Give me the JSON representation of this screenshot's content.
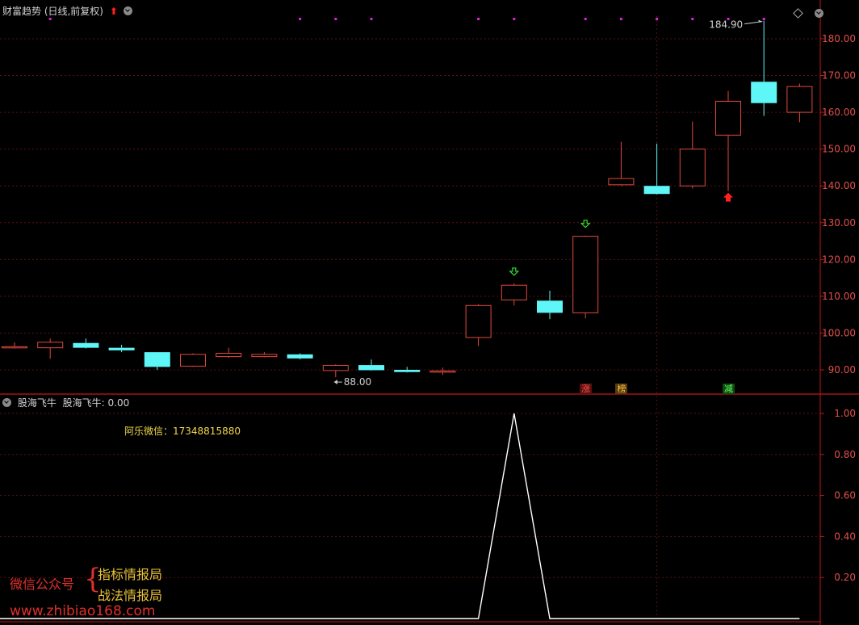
{
  "main_panel": {
    "title": "财富趋势 (日线,前复权)",
    "up_icon": "red-up-arrow-icon",
    "menu_icon": "dropdown-circle-icon"
  },
  "sub_panel": {
    "title": "股海飞牛",
    "value_label": "股海飞牛: 0.00",
    "wechat": "阿乐微信：17348815880"
  },
  "watermark": {
    "line1": "微信公众号",
    "brace": "{",
    "line2": "指标情报局",
    "line3": "战法情报局",
    "line4": "www.zhibiao168.com"
  },
  "stamps": [
    {
      "text": "涨",
      "color": "#ff5050",
      "bg": "#5a1010"
    },
    {
      "text": "榜",
      "color": "#f0c040",
      "bg": "#5a3a10"
    },
    {
      "text": "减",
      "color": "#60ff60",
      "bg": "#104a10"
    }
  ],
  "colors": {
    "up": "#e0483c",
    "down": "#5ef6f6",
    "grid": "#5a1010",
    "axis": "#c01818",
    "tick_text": "#e0504a",
    "marker": "#e020e0",
    "green_arrow": "#30e030",
    "red_arrow": "#ff2020",
    "sub_line": "#ffffff"
  },
  "chart_data": [
    {
      "type": "candlestick",
      "title": "财富趋势 (日线,前复权)",
      "ylim": [
        85,
        188
      ],
      "yticks": [
        90,
        100,
        110,
        120,
        130,
        140,
        150,
        160,
        170,
        180
      ],
      "ytick_labels": [
        "90.00",
        "100.00",
        "110.00",
        "120.00",
        "130.00",
        "140.00",
        "150.00",
        "160.00",
        "170.00",
        "180.00"
      ],
      "grid": true,
      "candles": [
        {
          "o": 96.0,
          "h": 97.5,
          "l": 95.8,
          "c": 96.3
        },
        {
          "o": 96.0,
          "h": 98.5,
          "l": 93.0,
          "c": 97.5
        },
        {
          "o": 97.3,
          "h": 98.5,
          "l": 95.8,
          "c": 96.0
        },
        {
          "o": 96.0,
          "h": 96.8,
          "l": 94.8,
          "c": 95.3
        },
        {
          "o": 94.8,
          "h": 94.8,
          "l": 90.0,
          "c": 90.8
        },
        {
          "o": 91.0,
          "h": 94.5,
          "l": 90.8,
          "c": 94.2
        },
        {
          "o": 93.6,
          "h": 96.0,
          "l": 93.3,
          "c": 94.5
        },
        {
          "o": 93.6,
          "h": 94.8,
          "l": 93.4,
          "c": 94.2
        },
        {
          "o": 94.2,
          "h": 94.5,
          "l": 92.8,
          "c": 93.1
        },
        {
          "o": 89.8,
          "h": 91.5,
          "l": 88.0,
          "c": 91.2
        },
        {
          "o": 91.3,
          "h": 92.8,
          "l": 89.8,
          "c": 89.9
        },
        {
          "o": 90.0,
          "h": 90.8,
          "l": 89.3,
          "c": 89.4
        },
        {
          "o": 89.6,
          "h": 90.6,
          "l": 88.6,
          "c": 89.7
        },
        {
          "o": 98.8,
          "h": 107.8,
          "l": 96.5,
          "c": 107.5
        },
        {
          "o": 109.0,
          "h": 113.5,
          "l": 107.5,
          "c": 113.0
        },
        {
          "o": 108.8,
          "h": 111.5,
          "l": 103.8,
          "c": 105.5
        },
        {
          "o": 105.5,
          "h": 126.5,
          "l": 104.0,
          "c": 126.3
        },
        {
          "o": 140.3,
          "h": 152.0,
          "l": 140.0,
          "c": 142.0
        },
        {
          "o": 140.0,
          "h": 151.5,
          "l": 137.7,
          "c": 137.8
        },
        {
          "o": 140.0,
          "h": 157.5,
          "l": 139.3,
          "c": 150.0
        },
        {
          "o": 153.8,
          "h": 165.8,
          "l": 138.6,
          "c": 163.0
        },
        {
          "o": 168.3,
          "h": 184.9,
          "l": 159.0,
          "c": 162.5
        },
        {
          "o": 160.0,
          "h": 167.8,
          "l": 157.3,
          "c": 167.0
        }
      ],
      "annotations": [
        {
          "text": "184.90",
          "index": 21,
          "value": 184.9
        },
        {
          "text": "88.00",
          "index": 9,
          "value": 88.0
        }
      ],
      "top_markers": [
        1,
        8,
        9,
        10,
        13,
        14,
        16,
        17,
        18,
        19,
        20,
        21
      ],
      "down_arrows": [
        14,
        16
      ],
      "up_arrows": [
        20
      ],
      "stamp_positions": [
        16,
        17,
        20
      ],
      "vertical_dashed": [
        18
      ]
    },
    {
      "type": "line",
      "title": "股海飞牛",
      "ylim": [
        0,
        1.05
      ],
      "yticks": [
        0.2,
        0.4,
        0.6,
        0.8,
        1.0
      ],
      "ytick_labels": [
        "0.20",
        "0.40",
        "0.60",
        "0.80",
        "1.00"
      ],
      "series": [
        {
          "name": "股海飞牛",
          "values": [
            0,
            0,
            0,
            0,
            0,
            0,
            0,
            0,
            0,
            0,
            0,
            0,
            0,
            0,
            1,
            0,
            0,
            0,
            0,
            0,
            0,
            0,
            0
          ]
        }
      ]
    }
  ]
}
